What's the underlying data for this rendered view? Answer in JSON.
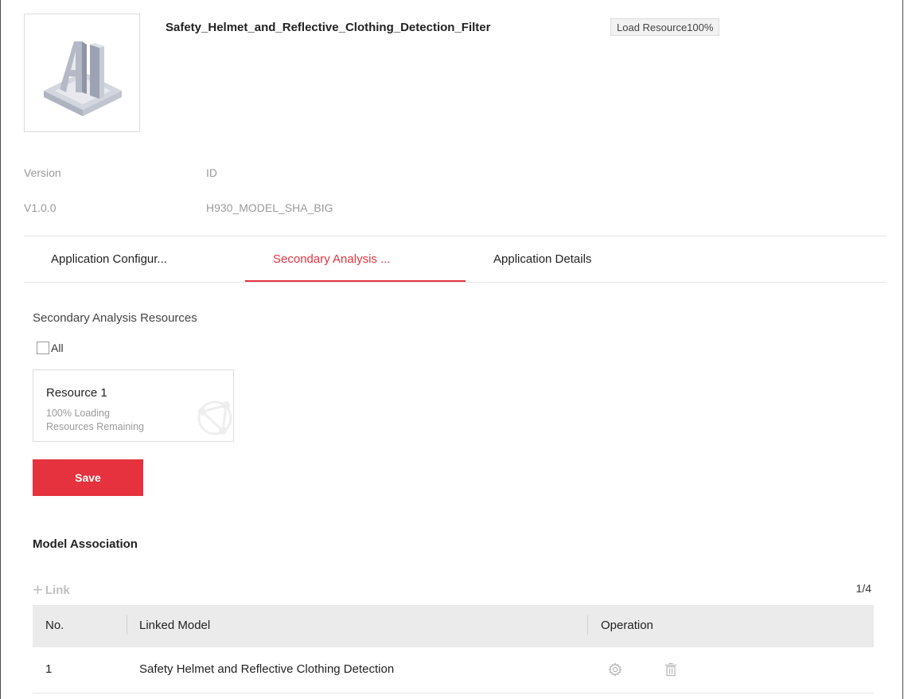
{
  "app": {
    "title": "Safety_Helmet_and_Reflective_Clothing_Detection_Filter",
    "badge": "Load Resource100%",
    "thumbnail_icon": "ai-logo-icon"
  },
  "meta": {
    "version_label": "Version",
    "id_label": "ID",
    "version_value": "V1.0.0",
    "id_value": "H930_MODEL_SHA_BIG"
  },
  "tabs": [
    {
      "label": "Application Configur..."
    },
    {
      "label": "Secondary Analysis ...",
      "active": true
    },
    {
      "label": "Application Details"
    }
  ],
  "secondary": {
    "section_label": "Secondary Analysis Resources",
    "all_label": "All",
    "all_checked": false,
    "resource": {
      "name": "Resource 1",
      "line1": "100% Loading",
      "line2": "Resources Remaining"
    },
    "save_label": "Save"
  },
  "model_association": {
    "heading": "Model Association",
    "link_label": "Link",
    "page_info": "1/4",
    "columns": [
      "No.",
      "Linked Model",
      "Operation"
    ],
    "rows": [
      {
        "no": "1",
        "model": "Safety Helmet and Reflective Clothing Detection",
        "ops": [
          "gear-icon",
          "trash-icon"
        ]
      }
    ]
  },
  "colors": {
    "accent": "#e5323e",
    "table_header_bg": "#ebebeb",
    "muted_text": "#9a9a9a"
  }
}
